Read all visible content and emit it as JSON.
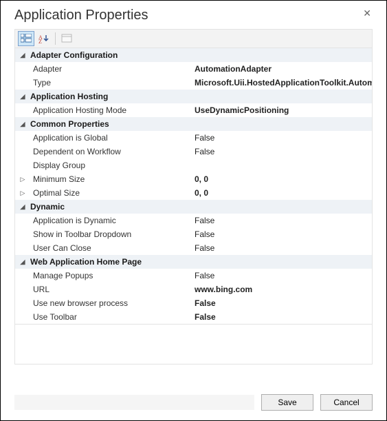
{
  "window": {
    "title": "Application Properties",
    "close_label": "✕"
  },
  "toolbar": {
    "categorized_label": "Categorized",
    "alpha_label": "Alphabetical",
    "pages_label": "Property Pages"
  },
  "categories": [
    {
      "name": "Adapter Configuration",
      "expanded": true,
      "props": [
        {
          "name": "Adapter",
          "value": "AutomationAdapter",
          "bold": true
        },
        {
          "name": "Type",
          "value": "Microsoft.Uii.HostedApplicationToolkit.AutomationAdapter",
          "bold": true
        }
      ]
    },
    {
      "name": "Application Hosting",
      "expanded": true,
      "props": [
        {
          "name": "Application Hosting Mode",
          "value": "UseDynamicPositioning",
          "bold": true
        }
      ]
    },
    {
      "name": "Common Properties",
      "expanded": true,
      "props": [
        {
          "name": "Application is Global",
          "value": "False"
        },
        {
          "name": "Dependent on Workflow",
          "value": "False"
        },
        {
          "name": "Display Group",
          "value": ""
        },
        {
          "name": "Minimum Size",
          "value": "0, 0",
          "expandable": true,
          "bold": true
        },
        {
          "name": "Optimal Size",
          "value": "0, 0",
          "expandable": true,
          "bold": true
        }
      ]
    },
    {
      "name": "Dynamic",
      "expanded": true,
      "props": [
        {
          "name": "Application is Dynamic",
          "value": "False"
        },
        {
          "name": "Show in Toolbar Dropdown",
          "value": "False"
        },
        {
          "name": "User Can Close",
          "value": "False"
        }
      ]
    },
    {
      "name": "Web Application Home Page",
      "expanded": true,
      "props": [
        {
          "name": "Manage Popups",
          "value": "False"
        },
        {
          "name": "URL",
          "value": "www.bing.com",
          "bold": true
        },
        {
          "name": "Use new browser process",
          "value": "False",
          "bold": true
        },
        {
          "name": "Use Toolbar",
          "value": "False",
          "bold": true
        }
      ]
    }
  ],
  "footer": {
    "save_label": "Save",
    "cancel_label": "Cancel"
  }
}
